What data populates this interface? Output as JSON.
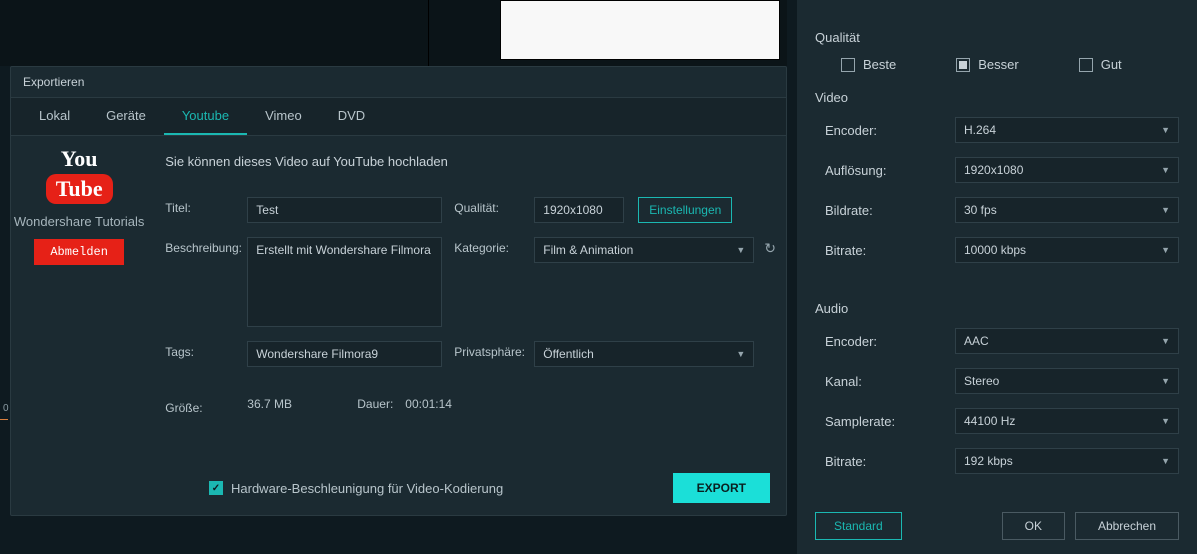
{
  "export": {
    "title": "Exportieren",
    "tabs": {
      "local": "Lokal",
      "device": "Geräte",
      "youtube": "Youtube",
      "vimeo": "Vimeo",
      "dvd": "DVD"
    },
    "youtube": {
      "logo_you": "You",
      "logo_tube": "Tube",
      "account": "Wondershare Tutorials",
      "logout": "Abmelden",
      "intro": "Sie können dieses Video auf YouTube hochladen",
      "labels": {
        "title": "Titel:",
        "desc": "Beschreibung:",
        "tags": "Tags:",
        "quality": "Qualität:",
        "category": "Kategorie:",
        "privacy": "Privatsphäre:",
        "size": "Größe:",
        "duration": "Dauer:"
      },
      "values": {
        "title": "Test",
        "desc": "Erstellt mit Wondershare Filmora",
        "tags": "Wondershare Filmora9",
        "quality": "1920x1080",
        "category": "Film & Animation",
        "privacy": "Öffentlich",
        "size": "36.7 MB",
        "duration": "00:01:14"
      },
      "settings_button": "Einstellungen",
      "hw_accel": "Hardware-Beschleunigung für Video-Kodierung",
      "export_button": "EXPORT"
    }
  },
  "timeline_tick": "0",
  "settings": {
    "panel_title": "",
    "quality": {
      "label": "Qualität",
      "options": {
        "best": "Beste",
        "better": "Besser",
        "good": "Gut"
      },
      "selected": "better"
    },
    "video": {
      "label": "Video",
      "encoder_label": "Encoder:",
      "encoder": "H.264",
      "resolution_label": "Auflösung:",
      "resolution": "1920x1080",
      "framerate_label": "Bildrate:",
      "framerate": "30 fps",
      "bitrate_label": "Bitrate:",
      "bitrate": "10000 kbps"
    },
    "audio": {
      "label": "Audio",
      "encoder_label": "Encoder:",
      "encoder": "AAC",
      "channel_label": "Kanal:",
      "channel": "Stereo",
      "samplerate_label": "Samplerate:",
      "samplerate": "44100 Hz",
      "bitrate_label": "Bitrate:",
      "bitrate": "192 kbps"
    },
    "buttons": {
      "standard": "Standard",
      "ok": "OK",
      "cancel": "Abbrechen"
    }
  }
}
